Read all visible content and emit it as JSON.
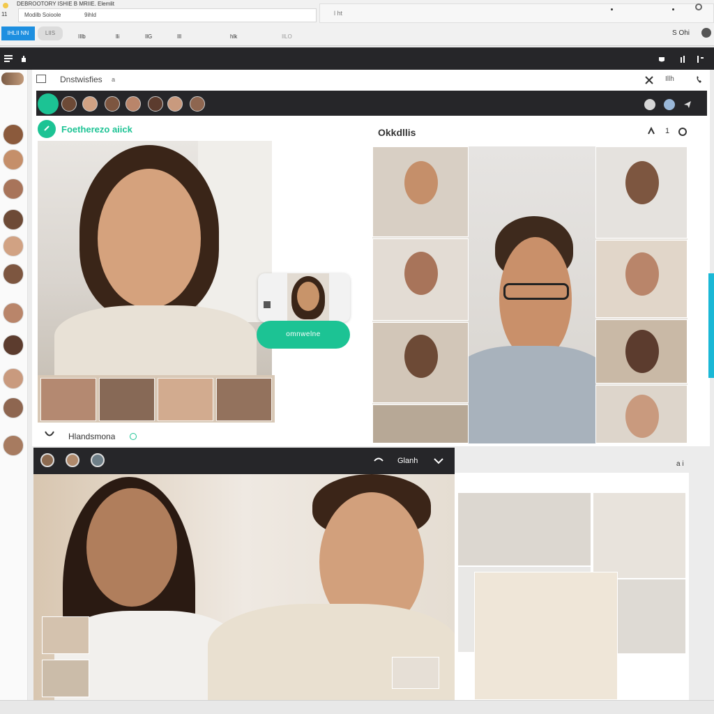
{
  "browser": {
    "tab_title": "DEBROOTORY ISHIE B  MRIIE. Elemlit",
    "address_text": "9ihld",
    "address_hint": "Modilb Soioole",
    "extra_url_text": "l ht",
    "toolbar_primary": "IHLII NN",
    "toolbar_secondary": "LIIS",
    "toolbar_items": [
      "IIlb",
      "lli",
      "IlG",
      "IlI",
      "hlk",
      "IlLO"
    ],
    "right_text": "S  Ohi"
  },
  "app": {
    "accent": "#1cc394",
    "brand_color": "#1d8fe0",
    "section_title": "Dnstwisfies",
    "section_title_suffix": "a",
    "header_right_text": "Illh",
    "featured_label": "Foetherezo aiick",
    "right_panel_title": "Okkdllis",
    "right_panel_count": "1",
    "popup_button": "omnwelne",
    "speaker_name": "Hlandsmona",
    "bottom_bar_label": "Glanh",
    "right_corner_text": "a i"
  },
  "icons": {
    "minimize": "window-icon",
    "hand": "hand-icon",
    "close": "close-icon",
    "phone": "phone-icon",
    "send": "send-icon",
    "chevron": "chevron-down-icon"
  }
}
